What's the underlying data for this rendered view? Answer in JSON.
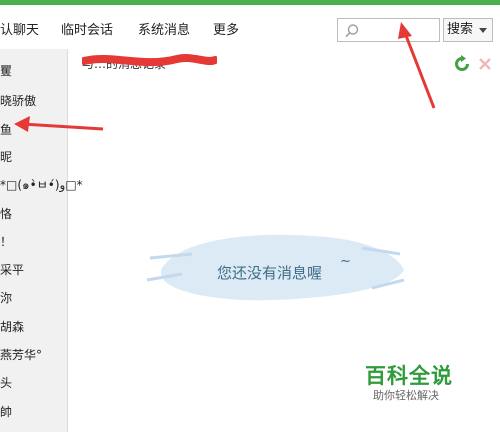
{
  "tabs": [
    "认聊天",
    "临时会话",
    "系统消息",
    "更多"
  ],
  "search": {
    "button_label": "搜索"
  },
  "sidebar": {
    "items": [
      "矍",
      "晓骄傲",
      "鱼",
      "昵",
      "*□(๑•̀ㅂ•́)و□*",
      "恪",
      "！",
      "采平",
      "沵",
      "胡森",
      "燕芳华°",
      "头",
      "帥"
    ]
  },
  "main": {
    "header_text": "与…的消息记录",
    "empty_message": "您还没有消息喔",
    "empty_tilde": "~"
  },
  "watermark": {
    "title": "百科全说",
    "subtitle": "助你轻松解决"
  },
  "colors": {
    "accent": "#4caf50",
    "annotation_arrow": "#e53935",
    "watermark": "#2e9b3c",
    "cloud": "#cfe2f3"
  }
}
